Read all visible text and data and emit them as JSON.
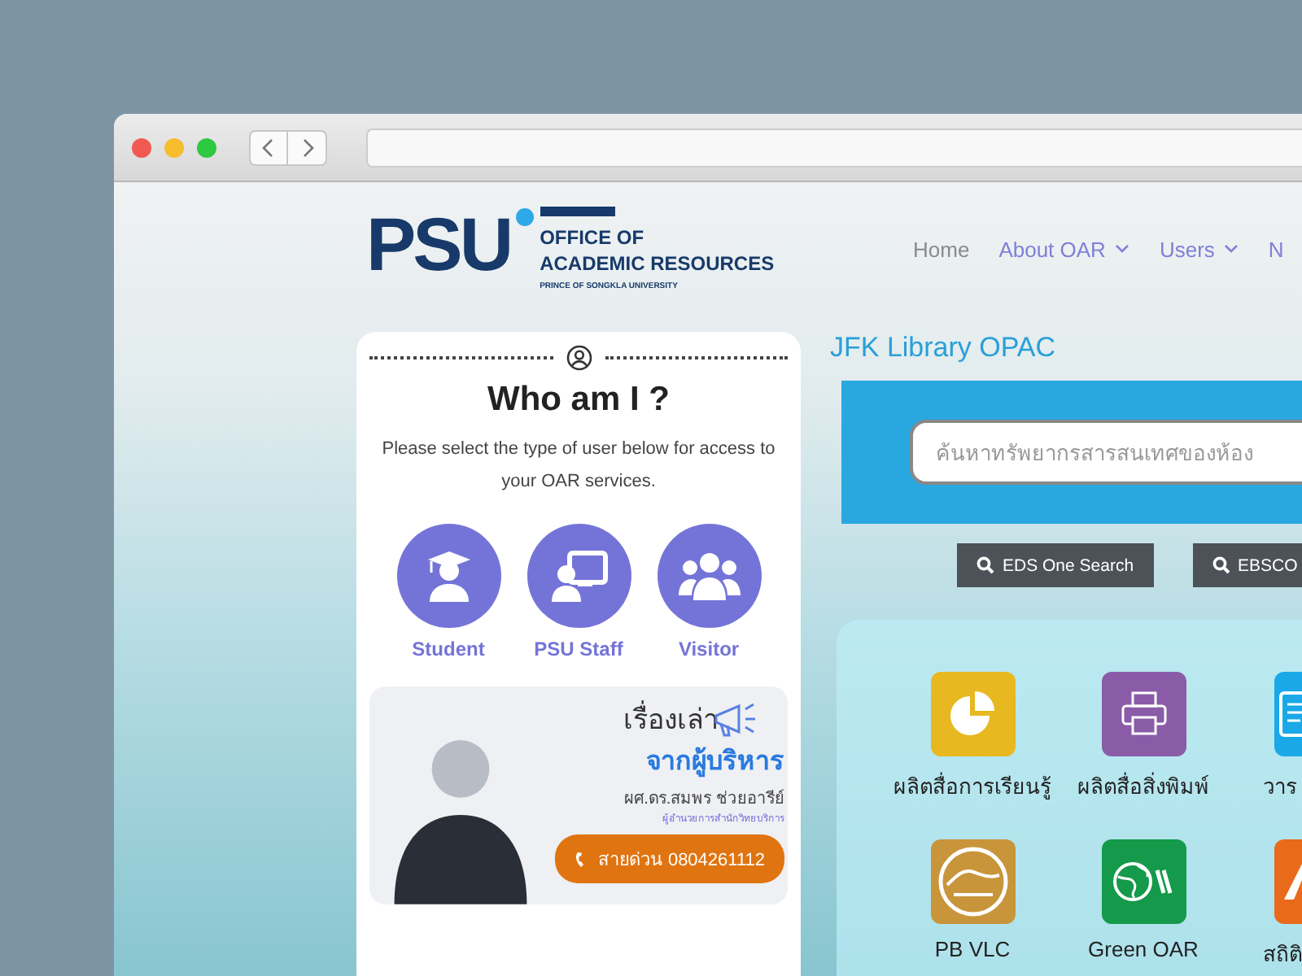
{
  "header": {
    "logo": {
      "mark": "PSU",
      "title_lines": [
        "OFFICE OF",
        "ACADEMIC RESOURCES"
      ],
      "subtitle": "PRINCE OF SONGKLA UNIVERSITY"
    },
    "nav": [
      {
        "label": "Home",
        "kind": "link"
      },
      {
        "label": "About OAR",
        "kind": "dropdown"
      },
      {
        "label": "Users",
        "kind": "dropdown"
      },
      {
        "label": "N",
        "kind": "link-accent"
      }
    ]
  },
  "who_am_i": {
    "title": "Who am I ?",
    "description": "Please select the type of user below for access to your OAR services.",
    "user_types": [
      {
        "label": "Student",
        "kind": "student"
      },
      {
        "label": "PSU Staff",
        "kind": "staff"
      },
      {
        "label": "Visitor",
        "kind": "visitor"
      }
    ]
  },
  "banner": {
    "heading": "เรื่องเล่า",
    "subheading": "จากผู้บริหาร",
    "name": "ผศ.ดร.สมพร ช่วยอารีย์",
    "position": "ผู้อำนวยการสำนักวิทยบริการ",
    "hotline": "สายด่วน 0804261112"
  },
  "opac": {
    "title": "JFK Library OPAC",
    "search": {
      "placeholder": "ค้นหาทรัพยากรสารสนเทศของห้อง"
    },
    "buttons": [
      "EDS One Search",
      "EBSCO"
    ]
  },
  "services": [
    {
      "label": "ผลิตสื่อการเรียนรู้",
      "kind": "pie",
      "color": "#e8b820"
    },
    {
      "label": "ผลิตสื่อสิ่งพิมพ์",
      "kind": "printer",
      "color": "#8a5ca8"
    },
    {
      "label": "วาร",
      "kind": "document",
      "color": "#1aa8e8"
    },
    {
      "label": "PB VLC",
      "kind": "badge",
      "color": "#c8953a"
    },
    {
      "label": "Green OAR",
      "kind": "globe",
      "color": "#149a4a"
    },
    {
      "label": "สถิติ",
      "kind": "letter",
      "color": "#e86a1a"
    }
  ]
}
